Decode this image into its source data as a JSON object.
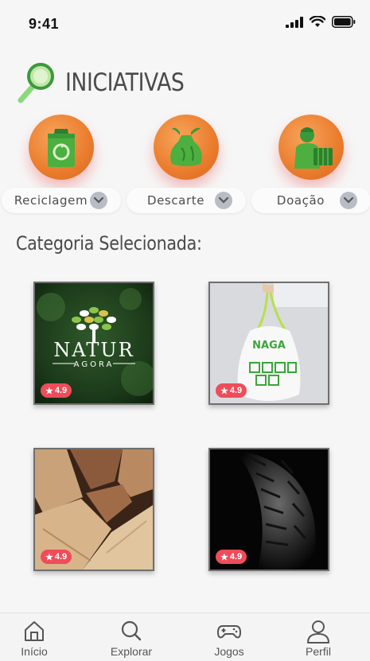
{
  "status_bar": {
    "time": "9:41"
  },
  "header": {
    "title": "INICIATIVAS",
    "icon": "magnifier-icon"
  },
  "initiatives": [
    {
      "label": "Reciclagem",
      "icon": "recycle-bag-icon"
    },
    {
      "label": "Descarte",
      "icon": "trash-bag-icon"
    },
    {
      "label": "Doação",
      "icon": "donation-person-icon"
    }
  ],
  "section": {
    "title": "Categoria Selecionada:"
  },
  "cards": [
    {
      "image": "natur-agora-logo",
      "logo_text": "NATUR",
      "logo_sub": "AGORA",
      "rating": "4.9"
    },
    {
      "image": "garbage-bag-photo",
      "bag_text": "NAGA",
      "rating": "4.9"
    },
    {
      "image": "firewood-photo",
      "rating": "4.9"
    },
    {
      "image": "tire-photo",
      "rating": "4.9"
    }
  ],
  "tabbar": [
    {
      "label": "Início",
      "icon": "home-icon"
    },
    {
      "label": "Explorar",
      "icon": "search-icon"
    },
    {
      "label": "Jogos",
      "icon": "gamepad-icon"
    },
    {
      "label": "Perfil",
      "icon": "user-icon"
    }
  ],
  "colors": {
    "accent_orange": "#ea7c2d",
    "accent_green": "#3a9a3a",
    "rating_red": "#ef4c5a"
  }
}
